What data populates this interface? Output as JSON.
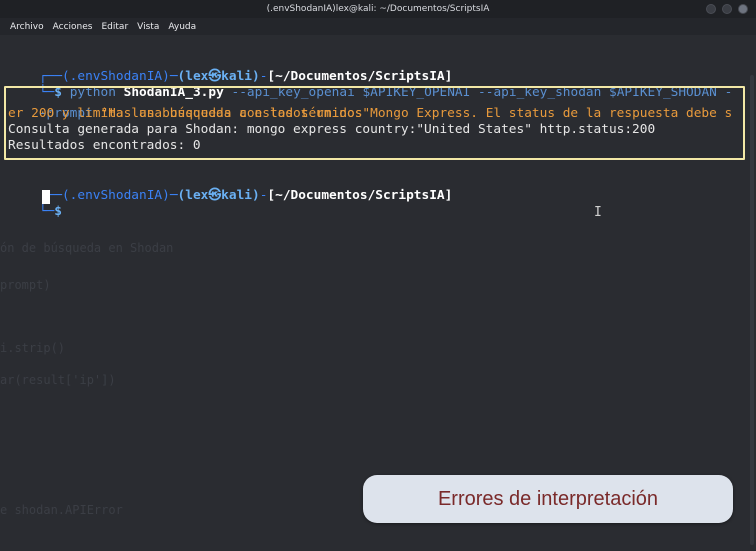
{
  "window": {
    "title": "(.envShodanIA)lex@kali: ~/Documentos/ScriptsIA"
  },
  "menu": [
    "Archivo",
    "Acciones",
    "Editar",
    "Vista",
    "Ayuda"
  ],
  "terminal": {
    "prompt1": {
      "box_start": "┌──",
      "env": "(.envShodanIA)",
      "dash": "─",
      "user_host": "(lex㉿kali)",
      "dash2": "-",
      "path": "[~/Documentos/ScriptsIA]"
    },
    "prompt1_tail": "└─",
    "dollar": "$",
    "command_line1_a": "python ",
    "command_line1_b": "ShodanIA_3.py",
    "command_line1_c": " --api_key_openai $APIKEY_OPENAI --api_key_shodan $APIKEY_SHODAN -",
    "command_line2_a": "-prompt ",
    "command_line2_b": "\"Has una búsqueda con los términos Mongo Express. El status de la respuesta debe s",
    "command_line3": "er 200 y limita las busquedas a estados unidos\"",
    "output1": "Consulta generada para Shodan: mongo express country:\"United States\" http.status:200",
    "output2": "Resultados encontrados: 0",
    "prompt2": {
      "box_start": "┌──",
      "env": "(.envShodanIA)",
      "dash": "─",
      "user_host": "(lex㉿kali)",
      "dash2": "-",
      "path": "[~/Documentos/ScriptsIA]"
    },
    "prompt2_tail": "└─",
    "dollar2": "$"
  },
  "ghost_text": [
    "ón de búsqueda en Shodan",
    "prompt)",
    "i.strip()",
    "ar(result['ip'])",
    "e shodan.APIError"
  ],
  "caption": "Errores de interpretación"
}
